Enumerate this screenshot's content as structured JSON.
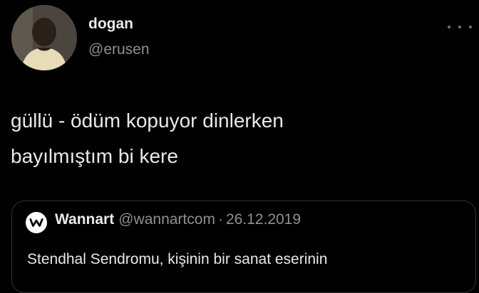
{
  "tweet": {
    "author": {
      "display_name": "dogan",
      "handle": "@erusen",
      "avatar_icon": "profile-photo"
    },
    "more_icon": "more-horizontal-icon",
    "text_lines": [
      "güllü - ödüm kopuyor dinlerken",
      "bayılmıştım bi kere"
    ]
  },
  "quoted_tweet": {
    "display_name": "Wannart",
    "handle": "@wannartcom",
    "separator": "·",
    "date": "26.12.2019",
    "logo_icon": "wannart-logo-icon",
    "text": "Stendhal Sendromu, kişinin bir sanat eserinin"
  },
  "colors": {
    "background": "#000000",
    "primary_text": "#e7e9ea",
    "secondary_text": "#8b9095",
    "border": "#2f3336"
  }
}
